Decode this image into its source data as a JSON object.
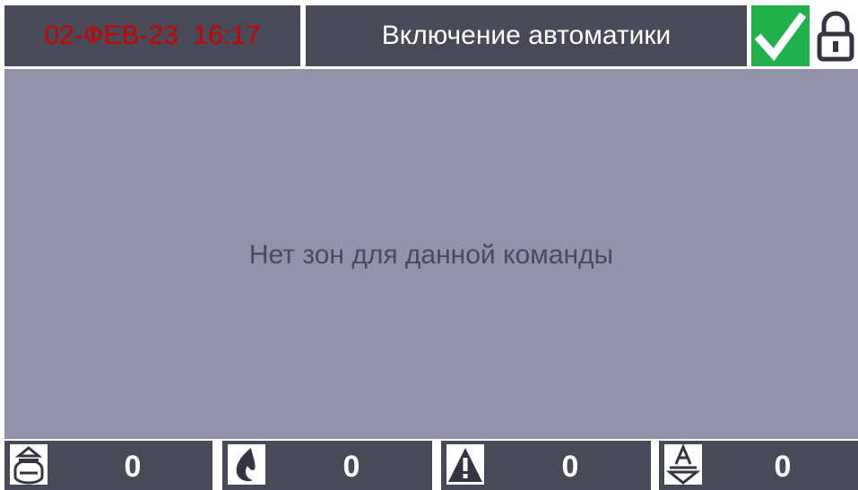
{
  "header": {
    "datetime": "02-ФЕВ-23  16:17",
    "title": "Включение автоматики",
    "status_icon": "checkmark-icon",
    "lock_icon": "padlock-icon"
  },
  "main": {
    "message": "Нет зон для данной команды"
  },
  "counters": [
    {
      "icon": "detector-icon",
      "value": "0"
    },
    {
      "icon": "fire-icon",
      "value": "0"
    },
    {
      "icon": "warning-icon",
      "value": "0"
    },
    {
      "icon": "automation-icon",
      "value": "0"
    }
  ],
  "colors": {
    "panel": "#484b57",
    "main_background": "#9292aa",
    "datetime_text": "#cc0000",
    "ok_status": "#22b04a"
  }
}
